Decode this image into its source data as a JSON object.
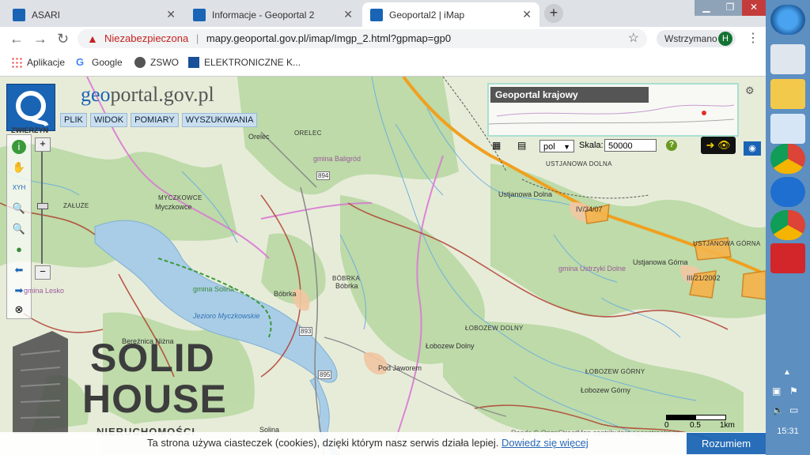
{
  "browser": {
    "tabs": [
      {
        "label": "ASARI",
        "favicon_color": "#1a64b5"
      },
      {
        "label": "Informacje - Geoportal 2",
        "favicon_color": "#1a64b5"
      },
      {
        "label": "Geoportal2 | iMap",
        "favicon_color": "#1a64b5"
      }
    ],
    "new_tab_label": "+",
    "security_label": "Niezabezpieczona",
    "url": "mapy.geoportal.gov.pl/imap/Imgp_2.html?gpmap=gp0",
    "profile_status": "Wstrzymano",
    "profile_initial": "H",
    "bookmarks": [
      {
        "label": "Aplikacje"
      },
      {
        "label": "Google"
      },
      {
        "label": "ZSWO"
      },
      {
        "label": "ELEKTRONICZNE K..."
      }
    ]
  },
  "geoportal": {
    "logo_prefix": "geo",
    "logo_suffix": "portal.gov.pl",
    "menu": [
      "PLIK",
      "WIDOK",
      "POMIARY",
      "WYSZUKIWANIA"
    ],
    "zoom_label": "ZWIERZYN",
    "overview_title": "Geoportal krajowy",
    "language": "pol",
    "scale_label": "Skala:",
    "scale_value": "50000",
    "help_label": "?"
  },
  "map_labels": [
    "ORELEC",
    "Orelec",
    "gmina Baligród",
    "MYCZKOWCE",
    "Myczkowce",
    "ZAŁUŻE",
    "USTJANOWA DOLNA",
    "Ustjanowa Dolna",
    "IV/34/07",
    "USTJANOWA GÓRNA",
    "Ustjanowa Górna",
    "gmina Ustrzyki Dolne",
    "III/21/2002",
    "gmina Lesko",
    "gmina Solina",
    "Jezioro Myczkowskie",
    "Bóbrka",
    "BÓBRKA",
    "Bóbrka",
    "Bereźnica Niżna",
    "ŁOBOZEW DOLNY",
    "Łobozew Dolny",
    "Pod Jaworem",
    "ŁOBOZEW GÓRNY",
    "Łobozew Górny",
    "Solina"
  ],
  "road_labels": [
    "894",
    "893",
    "895"
  ],
  "scalebar": {
    "ticks": [
      "0",
      "0.5",
      "1km"
    ]
  },
  "attribution": "Roads © OpenStreetMap contributors openstreetmap",
  "watermark": {
    "line1": "SOLID",
    "line2": "HOUSE",
    "line3": "NIERUCHOMOŚCI"
  },
  "cookie": {
    "text": "Ta strona używa ciasteczek (cookies), dzięki którym nasz serwis działa lepiej.",
    "link": "Dowiedz się więcej",
    "button": "Rozumiem"
  },
  "taskbar": {
    "time": "15:31"
  },
  "colors": {
    "accent": "#1a64b5",
    "forest": "#b9d9a3",
    "water": "#a9cde6",
    "border_purple": "#d97ad3",
    "road_orange": "#f0a020"
  }
}
